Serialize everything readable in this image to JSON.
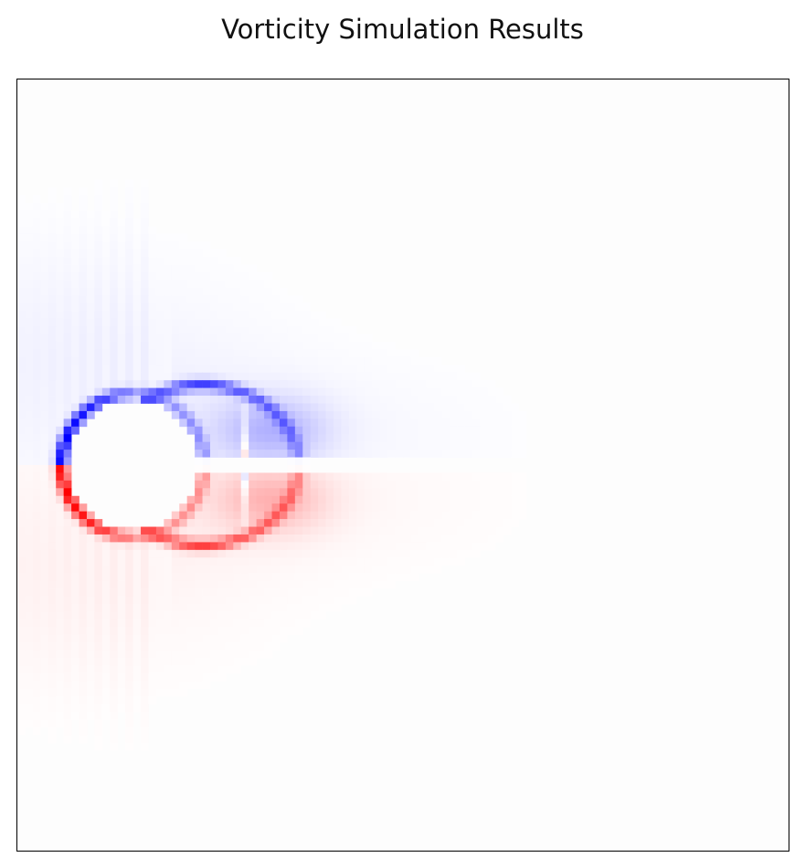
{
  "chart_data": {
    "type": "heatmap",
    "title": "Vorticity Simulation Results",
    "xlabel": "",
    "ylabel": "",
    "xticks": [],
    "yticks": [],
    "grid": false,
    "legend": "none",
    "colormap": "bwr",
    "colors": {
      "negative": "#0000ff",
      "zero": "#ffffff",
      "positive": "#ff0000",
      "frame": "#000000",
      "background": "#fdfdfd"
    },
    "grid_resolution": [
      100,
      100
    ],
    "obstacle": {
      "shape": "circle",
      "center": [
        15,
        50
      ],
      "radius": 9,
      "wake_cut": [
        15,
        31
      ]
    },
    "value_range": [
      -1,
      1
    ],
    "features": [
      {
        "name": "shear-layer-upper",
        "sign": -1,
        "peak": -1.0
      },
      {
        "name": "shear-layer-lower",
        "sign": 1,
        "peak": 1.0
      },
      {
        "name": "recirculation-upper",
        "sign": -1,
        "peak": -0.25
      },
      {
        "name": "recirculation-lower",
        "sign": 1,
        "peak": 0.25
      },
      {
        "name": "wake-upper",
        "sign": -1,
        "peak": -0.04
      },
      {
        "name": "wake-lower",
        "sign": 1,
        "peak": 0.04
      },
      {
        "name": "wake-centerline",
        "sign": 0,
        "peak": 0.0
      }
    ]
  }
}
